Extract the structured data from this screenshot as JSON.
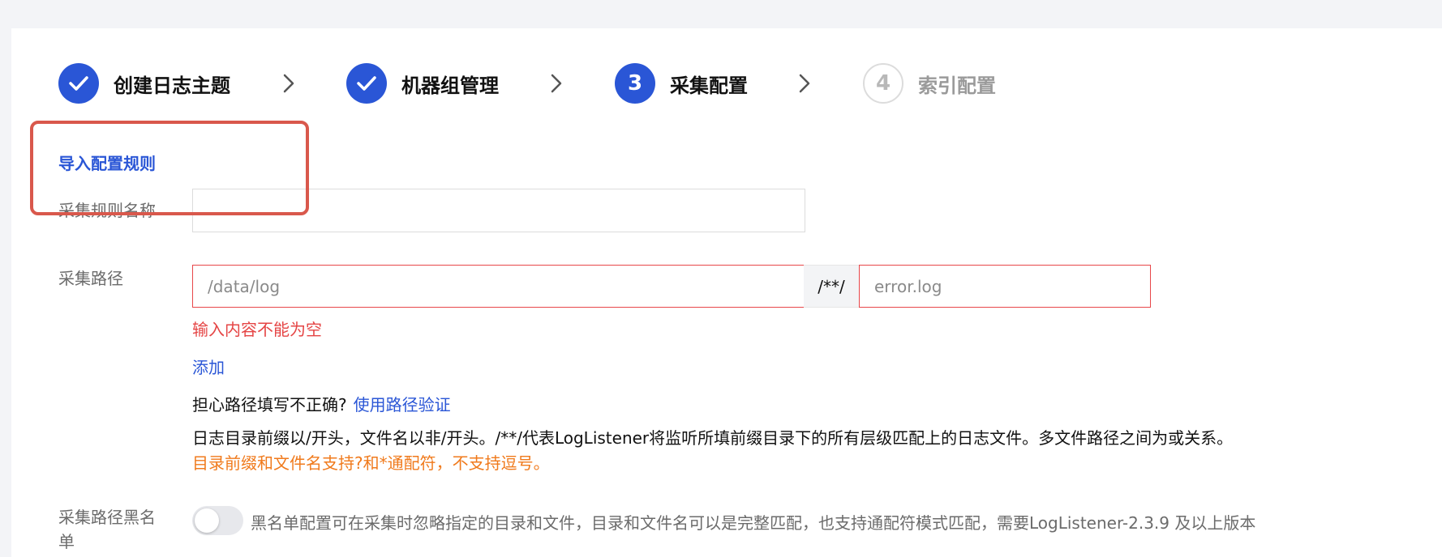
{
  "steps": [
    {
      "label": "创建日志主题",
      "status": "done",
      "number": "1"
    },
    {
      "label": "机器组管理",
      "status": "done",
      "number": "2"
    },
    {
      "label": "采集配置",
      "status": "active",
      "number": "3"
    },
    {
      "label": "索引配置",
      "status": "todo",
      "number": "4"
    }
  ],
  "colors": {
    "accent": "#2a56d6",
    "error": "#e54545",
    "warning": "#f07a1c",
    "highlight": "#d9584c",
    "background": "#f3f4f7"
  },
  "import_rule_link": "导入配置规则",
  "rule_name": {
    "label": "采集规则名称",
    "value": ""
  },
  "collection_path": {
    "label": "采集路径",
    "dir_placeholder": "/data/log",
    "separator": "/**/",
    "file_placeholder": "error.log",
    "error": "输入内容不能为空",
    "add_link": "添加",
    "verify_question": "担心路径填写不正确?",
    "verify_link": "使用路径验证",
    "description": "日志目录前缀以/开头，文件名以非/开头。/**/代表LogListener将监听所填前缀目录下的所有层级匹配上的日志文件。多文件路径之间为或关系。",
    "warning": "目录前缀和文件名支持?和*通配符，不支持逗号。"
  },
  "blacklist": {
    "label_line1": "采集路径黑名",
    "label_line2": "单",
    "enabled": false,
    "description": "黑名单配置可在采集时忽略指定的目录和文件，目录和文件名可以是完整匹配，也支持通配符模式匹配，需要LogListener-2.3.9 及以上版本"
  }
}
